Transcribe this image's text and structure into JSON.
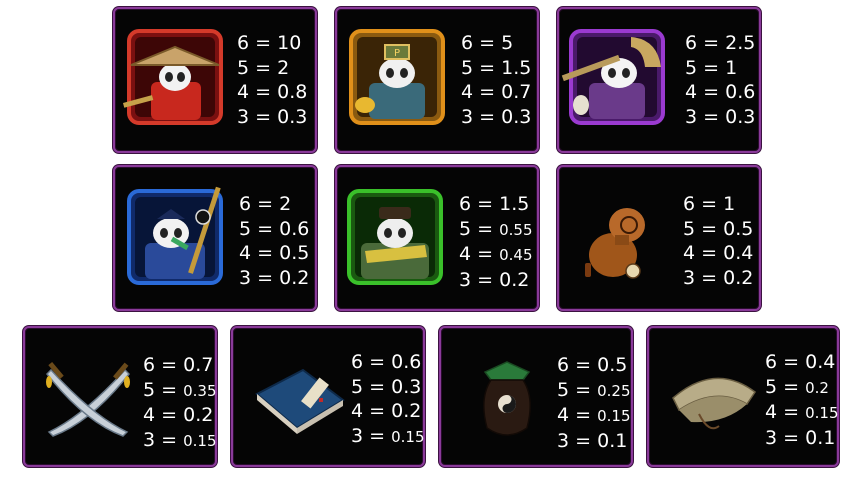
{
  "paytable": [
    {
      "symbol": "panda-samurai",
      "rows": [
        {
          "count": "6",
          "value": "10"
        },
        {
          "count": "5",
          "value": "2"
        },
        {
          "count": "4",
          "value": "0.8"
        },
        {
          "count": "3",
          "value": "0.3"
        }
      ]
    },
    {
      "symbol": "panda-merchant",
      "rows": [
        {
          "count": "6",
          "value": "5"
        },
        {
          "count": "5",
          "value": "1.5"
        },
        {
          "count": "4",
          "value": "0.7"
        },
        {
          "count": "3",
          "value": "0.3"
        }
      ]
    },
    {
      "symbol": "panda-monk",
      "rows": [
        {
          "count": "6",
          "value": "2.5"
        },
        {
          "count": "5",
          "value": "1"
        },
        {
          "count": "4",
          "value": "0.6"
        },
        {
          "count": "3",
          "value": "0.3"
        }
      ]
    },
    {
      "symbol": "panda-scholar",
      "rows": [
        {
          "count": "6",
          "value": "2"
        },
        {
          "count": "5",
          "value": "0.6"
        },
        {
          "count": "4",
          "value": "0.5"
        },
        {
          "count": "3",
          "value": "0.2"
        }
      ]
    },
    {
      "symbol": "panda-general",
      "rows": [
        {
          "count": "6",
          "value": "1.5"
        },
        {
          "count": "5",
          "value": "0.55"
        },
        {
          "count": "4",
          "value": "0.45"
        },
        {
          "count": "3",
          "value": "0.2"
        }
      ]
    },
    {
      "symbol": "gourd",
      "rows": [
        {
          "count": "6",
          "value": "1"
        },
        {
          "count": "5",
          "value": "0.5"
        },
        {
          "count": "4",
          "value": "0.4"
        },
        {
          "count": "3",
          "value": "0.2"
        }
      ]
    },
    {
      "symbol": "crossed-swords",
      "rows": [
        {
          "count": "6",
          "value": "0.7"
        },
        {
          "count": "5",
          "value": "0.35"
        },
        {
          "count": "4",
          "value": "0.2"
        },
        {
          "count": "3",
          "value": "0.15"
        }
      ]
    },
    {
      "symbol": "book",
      "rows": [
        {
          "count": "6",
          "value": "0.6"
        },
        {
          "count": "5",
          "value": "0.3"
        },
        {
          "count": "4",
          "value": "0.2"
        },
        {
          "count": "3",
          "value": "0.15"
        }
      ]
    },
    {
      "symbol": "wine-jar",
      "rows": [
        {
          "count": "6",
          "value": "0.5"
        },
        {
          "count": "5",
          "value": "0.25"
        },
        {
          "count": "4",
          "value": "0.15"
        },
        {
          "count": "3",
          "value": "0.1"
        }
      ]
    },
    {
      "symbol": "straw-hat",
      "rows": [
        {
          "count": "6",
          "value": "0.4"
        },
        {
          "count": "5",
          "value": "0.2"
        },
        {
          "count": "4",
          "value": "0.15"
        },
        {
          "count": "3",
          "value": "0.1"
        }
      ]
    }
  ],
  "separator": "="
}
